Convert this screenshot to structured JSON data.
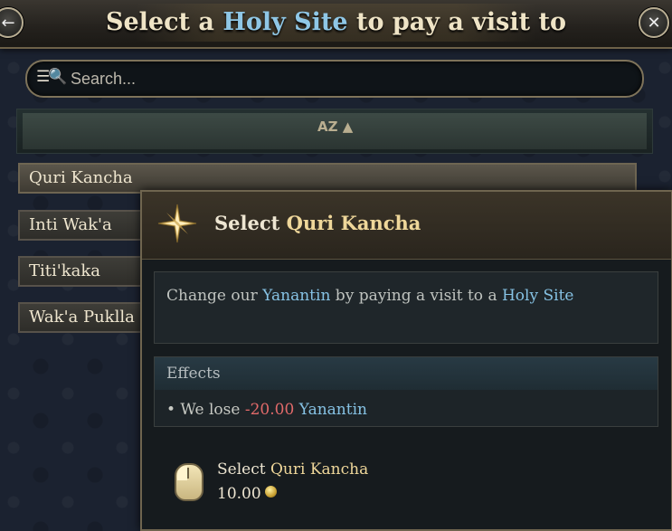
{
  "header": {
    "title_prefix": "Select a ",
    "title_highlight": "Holy Site",
    "title_suffix": " to pay a visit to",
    "back_icon": "←",
    "close_icon": "✕"
  },
  "search": {
    "icon": "☰🔍",
    "placeholder": "Search..."
  },
  "sort": {
    "label": "AZ ▲"
  },
  "list": {
    "items": [
      {
        "label": "Quri Kancha"
      },
      {
        "label": "Inti Wak'a"
      },
      {
        "label": "Titi'kaka"
      },
      {
        "label": "Wak'a Puklla"
      }
    ]
  },
  "tooltip": {
    "title_prefix": "Select ",
    "title_name": "Quri Kancha",
    "desc": {
      "p1": "Change our ",
      "h1": "Yanantin",
      "p2": " by paying a visit to a ",
      "h2": "Holy Site"
    },
    "effects": {
      "header": "Effects",
      "bullet": "• We lose ",
      "amount": "-20.00",
      "resource": "Yanantin"
    },
    "action": {
      "label_prefix": "Select ",
      "label_name": "Quri Kancha",
      "cost": "10.00"
    }
  },
  "colors": {
    "highlight_blue": "#86c2e4",
    "gold": "#efd79a",
    "negative": "#e26a6a"
  }
}
